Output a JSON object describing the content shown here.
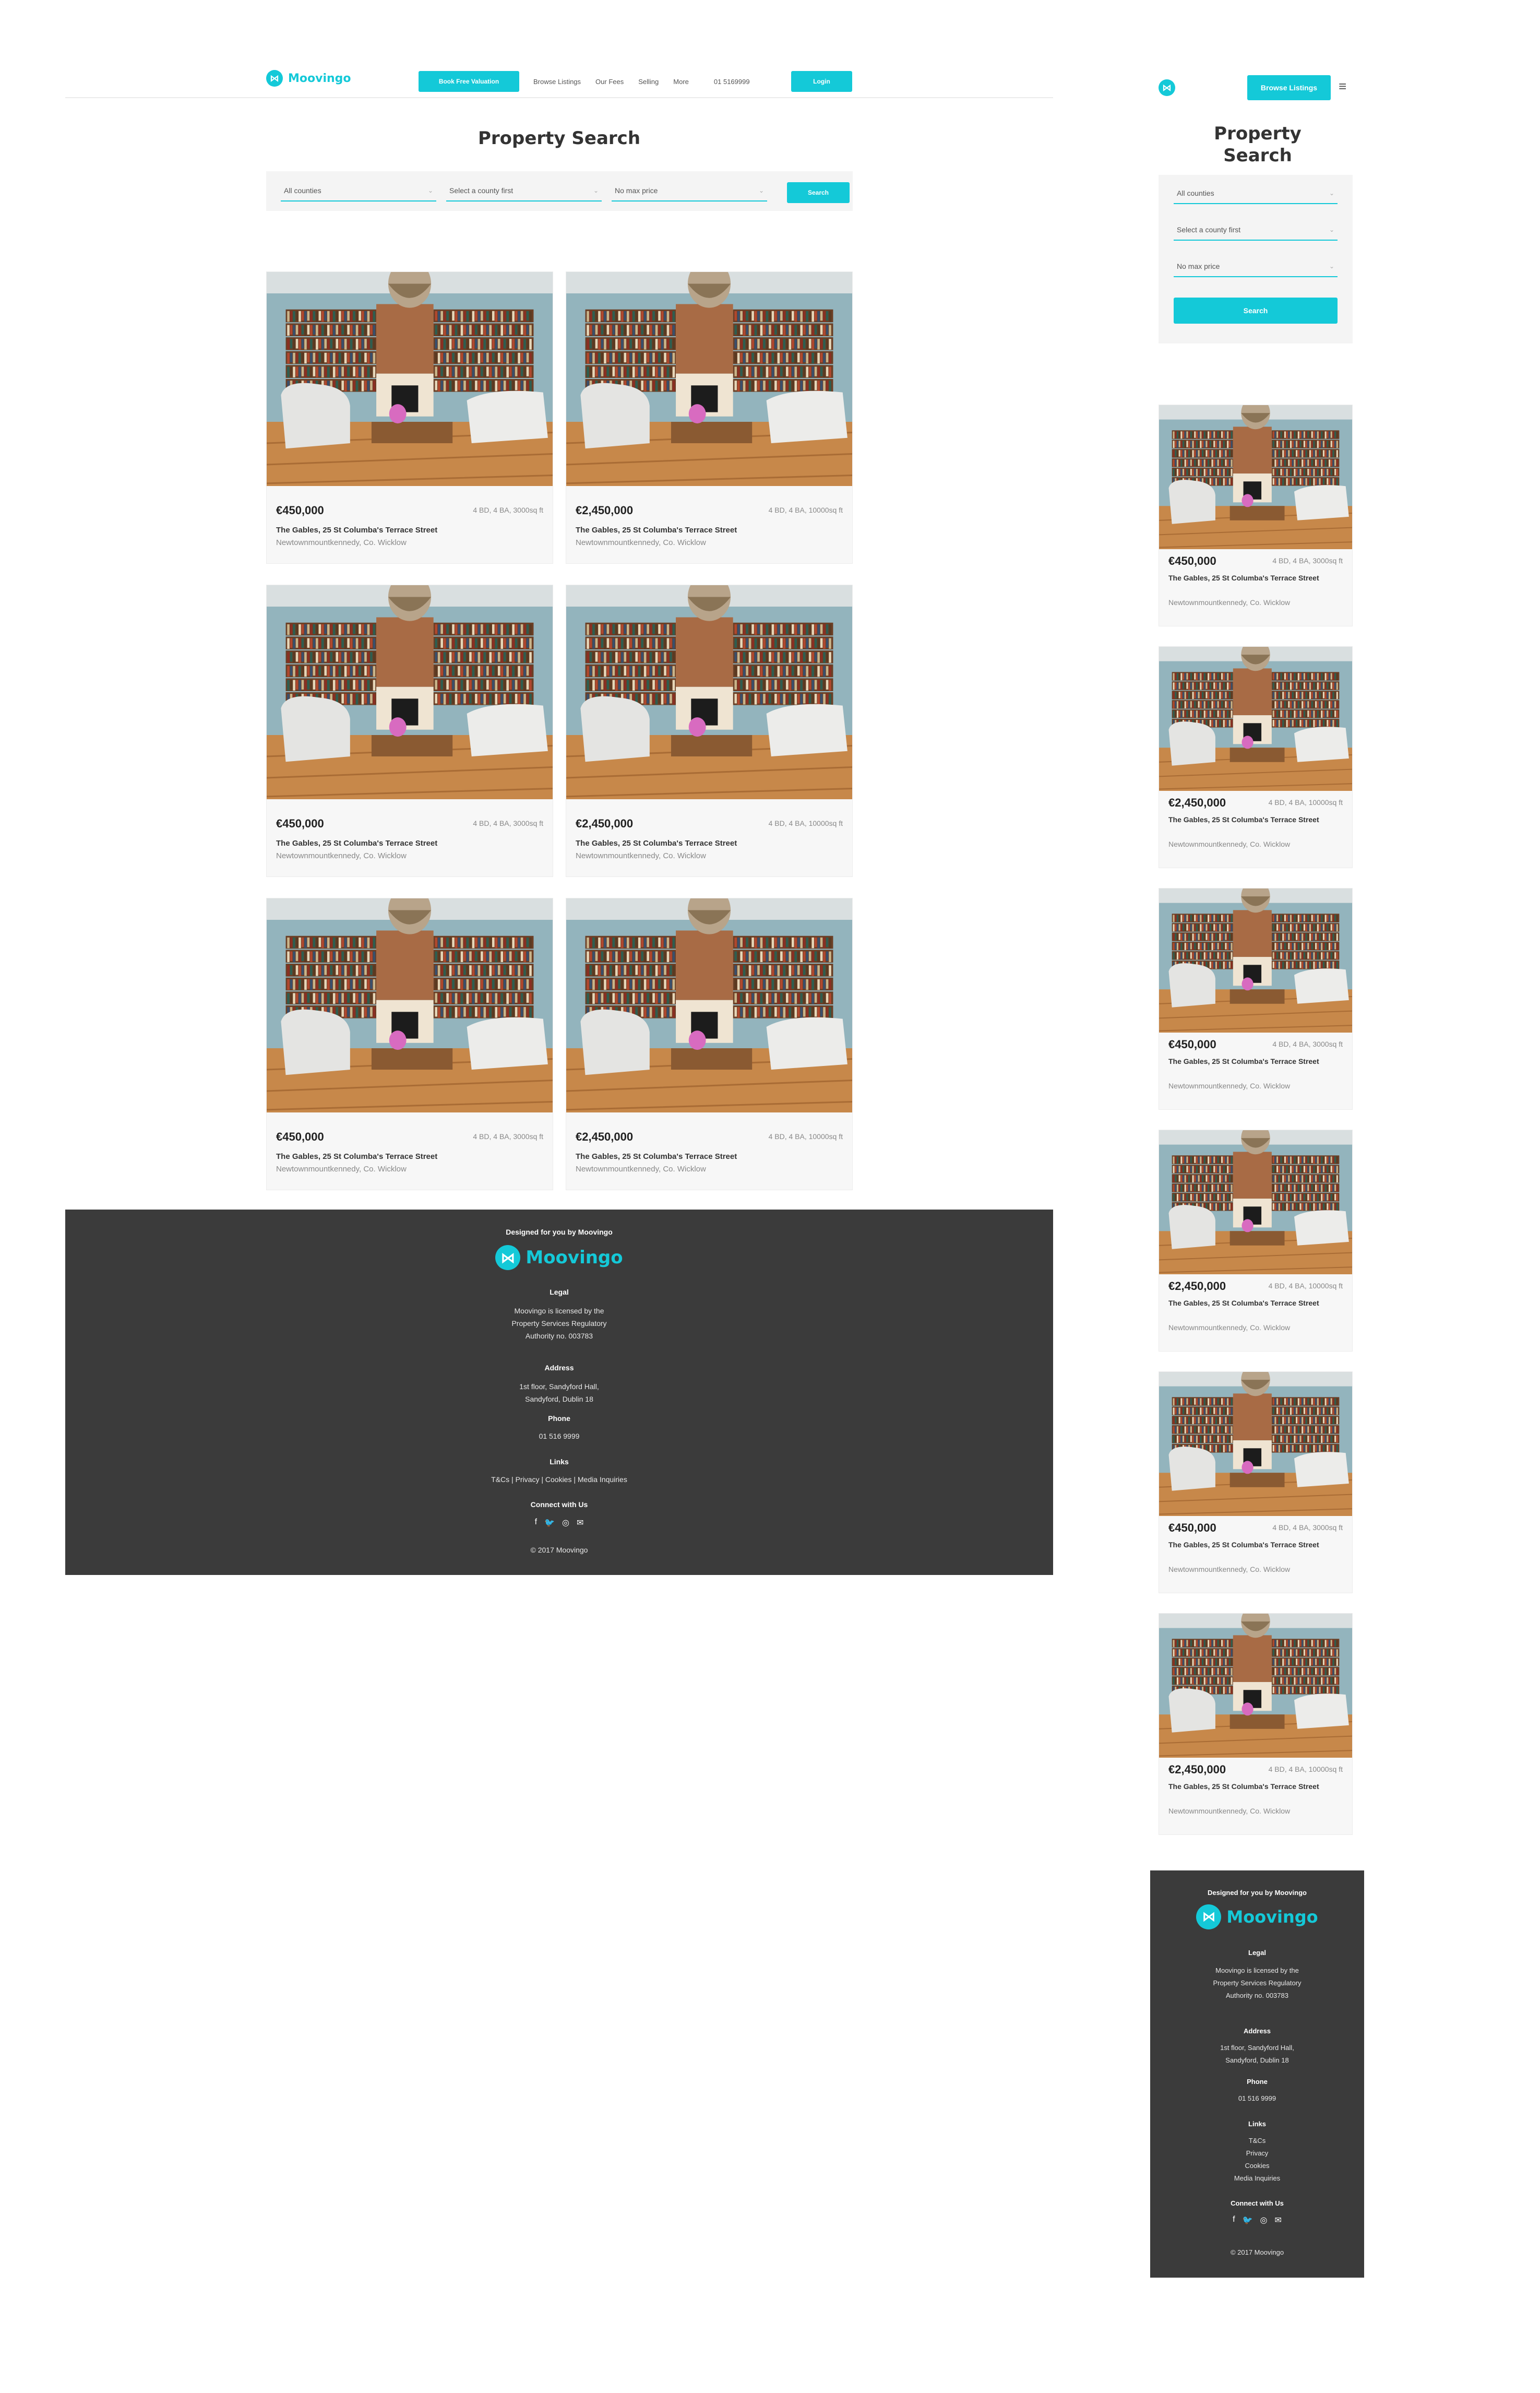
{
  "brand": {
    "name": "Moovingo",
    "accent": "#14c9d8",
    "footer_bg": "#3b3b3b"
  },
  "desktop": {
    "nav": {
      "valuation": "Book Free Valuation",
      "links": [
        "Browse Listings",
        "Our Fees",
        "Selling",
        "More",
        "01 5169999"
      ],
      "login": "Login"
    },
    "title": "Property Search",
    "filters": {
      "county": "All counties",
      "area": "Select a county first",
      "price": "No max price",
      "search": "Search"
    }
  },
  "mobile": {
    "browse": "Browse Listings",
    "menu_icon": "hamburger-menu-icon",
    "title": "Property Search",
    "filters": {
      "county": "All counties",
      "area": "Select a county first",
      "price": "No max price",
      "search": "Search"
    }
  },
  "listings": [
    {
      "price": "€450,000",
      "specs": "4 BD, 4 BA, 3000sq ft",
      "address": "The Gables, 25 St Columba's Terrace Street",
      "area": "Newtownmountkennedy, Co. Wicklow"
    },
    {
      "price": "€2,450,000",
      "specs": "4 BD, 4 BA, 10000sq ft",
      "address": "The Gables, 25 St Columba's Terrace Street",
      "area": "Newtownmountkennedy, Co. Wicklow"
    },
    {
      "price": "€450,000",
      "specs": "4 BD, 4 BA, 3000sq ft",
      "address": "The Gables, 25 St Columba's Terrace Street",
      "area": "Newtownmountkennedy, Co. Wicklow"
    },
    {
      "price": "€2,450,000",
      "specs": "4 BD, 4 BA, 10000sq ft",
      "address": "The Gables, 25 St Columba's Terrace Street",
      "area": "Newtownmountkennedy, Co. Wicklow"
    },
    {
      "price": "€450,000",
      "specs": "4 BD, 4 BA, 3000sq ft",
      "address": "The Gables, 25 St Columba's Terrace Street",
      "area": "Newtownmountkennedy, Co. Wicklow"
    },
    {
      "price": "€2,450,000",
      "specs": "4 BD, 4 BA, 10000sq ft",
      "address": "The Gables, 25 St Columba's Terrace Street",
      "area": "Newtownmountkennedy, Co. Wicklow"
    }
  ],
  "footer": {
    "designed": "Designed for you by Moovingo",
    "legal_heading": "Legal",
    "legal_lines": [
      "Moovingo is licensed by the",
      "Property Services Regulatory",
      "Authority no. 003783"
    ],
    "address_heading": "Address",
    "address_lines": [
      "1st floor, Sandyford Hall,",
      "Sandyford, Dublin 18"
    ],
    "phone_heading": "Phone",
    "phone": "01 516 9999",
    "links_heading": "Links",
    "links_inline": "T&Cs | Privacy | Cookies | Media Inquiries",
    "links": [
      "T&Cs",
      "Privacy",
      "Cookies",
      "Media Inquiries"
    ],
    "connect_heading": "Connect with Us",
    "social_icons": [
      "facebook-icon",
      "twitter-icon",
      "instagram-icon",
      "email-icon"
    ],
    "copyright": "© 2017 Moovingo"
  }
}
